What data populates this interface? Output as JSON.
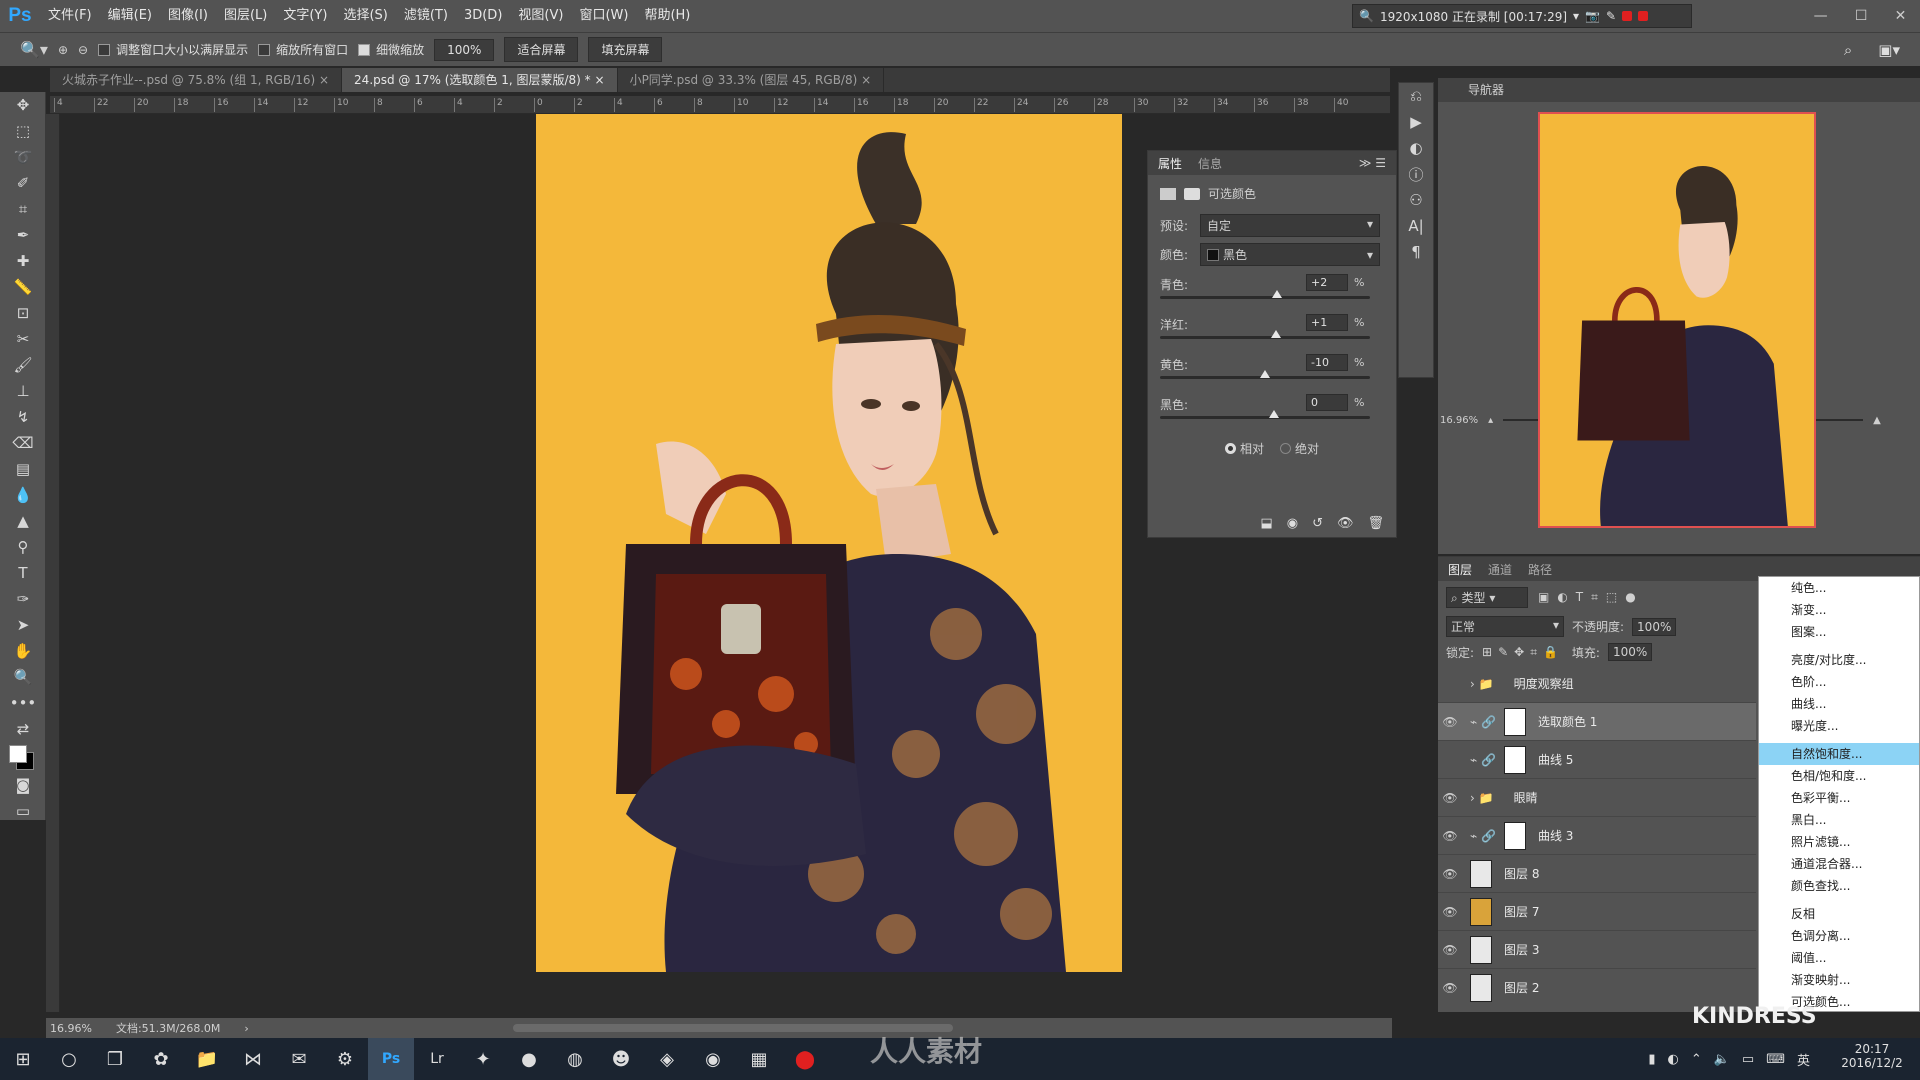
{
  "app": {
    "logo": "Ps"
  },
  "menubar": [
    "文件(F)",
    "编辑(E)",
    "图像(I)",
    "图层(L)",
    "文字(Y)",
    "选择(S)",
    "滤镜(T)",
    "3D(D)",
    "视图(V)",
    "窗口(W)",
    "帮助(H)"
  ],
  "recorder": {
    "text": "1920x1080 正在录制 [00:17:29]"
  },
  "options": {
    "resize_windows": "调整窗口大小以满屏显示",
    "zoom_all": "缩放所有窗口",
    "scrubby_zoom": "细微缩放",
    "zoom_value": "100%",
    "fit_screen": "适合屏幕",
    "fill_screen": "填充屏幕"
  },
  "tabs": [
    {
      "label": "火城赤子作业--.psd @ 75.8% (组 1, RGB/16)"
    },
    {
      "label": "24.psd @ 17% (选取颜色 1, 图层蒙版/8) *"
    },
    {
      "label": "小P同学.psd @ 33.3% (图层 45, RGB/8)"
    }
  ],
  "ruler_ticks": [
    "4",
    "22",
    "20",
    "18",
    "16",
    "14",
    "12",
    "10",
    "8",
    "6",
    "4",
    "2",
    "0",
    "2",
    "4",
    "6",
    "8",
    "10",
    "12",
    "14",
    "16",
    "18",
    "20",
    "22",
    "24",
    "26",
    "28",
    "30",
    "32",
    "34",
    "36",
    "38",
    "40"
  ],
  "properties": {
    "tabs": [
      "属性",
      "信息"
    ],
    "title": "可选颜色",
    "preset_label": "预设:",
    "preset_value": "自定",
    "color_label": "颜色:",
    "color_value": "黑色",
    "sliders": [
      {
        "label": "青色:",
        "value": "+2",
        "pos": 0.555
      },
      {
        "label": "洋红:",
        "value": "+1",
        "pos": 0.55
      },
      {
        "label": "黄色:",
        "value": "-10",
        "pos": 0.5
      },
      {
        "label": "黑色:",
        "value": "0",
        "pos": 0.545
      }
    ],
    "pct": "%",
    "relative": "相对",
    "absolute": "绝对"
  },
  "navigator": {
    "title": "导航器",
    "zoom": "16.96%"
  },
  "layers_panel": {
    "tabs": [
      "图层",
      "通道",
      "路径"
    ],
    "filter": "类型",
    "blend": "正常",
    "opacity_label": "不透明度:",
    "opacity": "100%",
    "lock_label": "锁定:",
    "fill_label": "填充:",
    "fill": "100%",
    "rows": [
      {
        "name": "明度观察组",
        "type": "group",
        "visible": false
      },
      {
        "name": "选取颜色 1",
        "type": "adj",
        "visible": true,
        "selected": true
      },
      {
        "name": "曲线 5",
        "type": "adj",
        "visible": false
      },
      {
        "name": "眼睛",
        "type": "group",
        "visible": true
      },
      {
        "name": "曲线 3",
        "type": "adj",
        "visible": true
      },
      {
        "name": "图层 8",
        "type": "pixel",
        "visible": true
      },
      {
        "name": "图层 7",
        "type": "pixel",
        "visible": true
      },
      {
        "name": "图层 3",
        "type": "pixel",
        "visible": true
      },
      {
        "name": "图层 2",
        "type": "pixel",
        "visible": true
      }
    ]
  },
  "context_menu": [
    "纯色...",
    "渐变...",
    "图案...",
    "-",
    "亮度/对比度...",
    "色阶...",
    "曲线...",
    "曝光度...",
    "-",
    "自然饱和度...",
    "色相/饱和度...",
    "色彩平衡...",
    "黑白...",
    "照片滤镜...",
    "通道混合器...",
    "颜色查找...",
    "-",
    "反相",
    "色调分离...",
    "阈值...",
    "渐变映射...",
    "可选颜色..."
  ],
  "context_highlight": "自然饱和度...",
  "status": {
    "zoom": "16.96%",
    "doc": "文档:51.3M/268.0M"
  },
  "watermark": "人人素材",
  "kindness": "KINDRESS",
  "clock": {
    "time": "20:17",
    "date": "2016/12/2"
  },
  "colors": {
    "ui_dark": "#535353",
    "canvas_bg": "#282828",
    "photo_bg": "#f4b83a",
    "accent": "#31a8ff"
  }
}
